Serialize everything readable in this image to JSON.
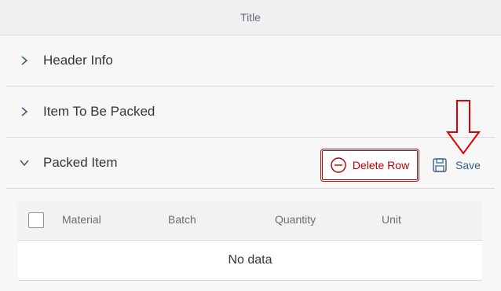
{
  "window": {
    "title": "Title"
  },
  "sections": [
    {
      "label": "Header Info",
      "expanded": false,
      "icon": "chevron-right-icon"
    },
    {
      "label": "Item To Be Packed",
      "expanded": false,
      "icon": "chevron-right-icon"
    },
    {
      "label": "Packed Item",
      "expanded": true,
      "icon": "chevron-down-icon"
    }
  ],
  "toolbar": {
    "delete_label": "Delete Row",
    "delete_icon": "minus-circle-icon",
    "save_label": "Save",
    "save_icon": "floppy-disk-icon"
  },
  "table": {
    "columns": [
      "Material",
      "Batch",
      "Quantity",
      "Unit"
    ],
    "empty_text": "No data"
  },
  "annotation": {
    "icon": "red-down-arrow-icon",
    "color": "#e00000"
  },
  "colors": {
    "accent": "#346187",
    "danger": "#b00000"
  }
}
